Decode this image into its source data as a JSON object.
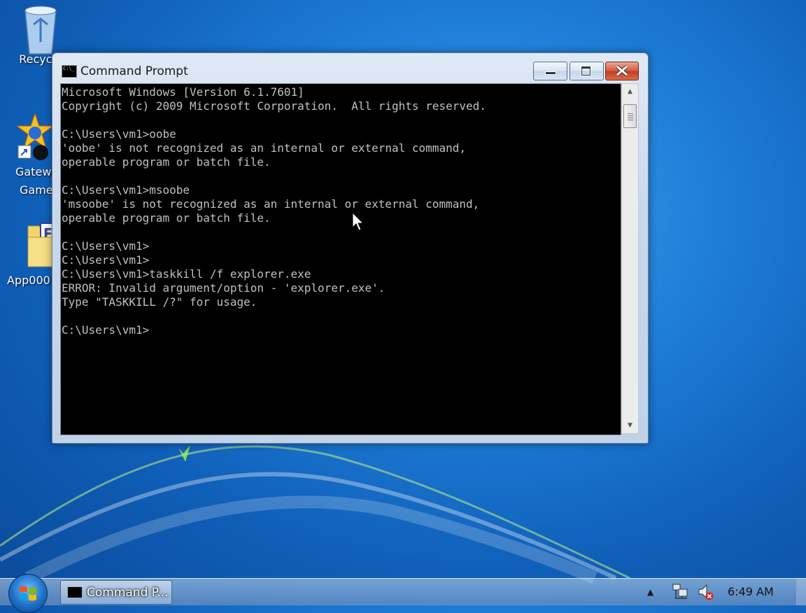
{
  "desktop": {
    "icons": [
      {
        "label": "Recycle"
      },
      {
        "label": "Gatewa"
      },
      {
        "label": "Game"
      },
      {
        "label": "App000"
      }
    ]
  },
  "window": {
    "title": "Command Prompt",
    "console_lines": [
      "Microsoft Windows [Version 6.1.7601]",
      "Copyright (c) 2009 Microsoft Corporation.  All rights reserved.",
      "",
      "C:\\Users\\vm1>oobe",
      "'oobe' is not recognized as an internal or external command,",
      "operable program or batch file.",
      "",
      "C:\\Users\\vm1>msoobe",
      "'msoobe' is not recognized as an internal or external command,",
      "operable program or batch file.",
      "",
      "C:\\Users\\vm1>",
      "C:\\Users\\vm1>",
      "C:\\Users\\vm1>taskkill /f explorer.exe",
      "ERROR: Invalid argument/option - 'explorer.exe'.",
      "Type \"TASKKILL /?\" for usage.",
      "",
      "C:\\Users\\vm1>"
    ]
  },
  "taskbar": {
    "task_label": "Command P...",
    "clock": "6:49 AM"
  },
  "icons": {
    "recycle": "recycle-bin-icon",
    "gateway": "game-shortcut-icon",
    "app": "folder-icon",
    "network": "network-icon",
    "volume": "volume-muted-icon"
  }
}
